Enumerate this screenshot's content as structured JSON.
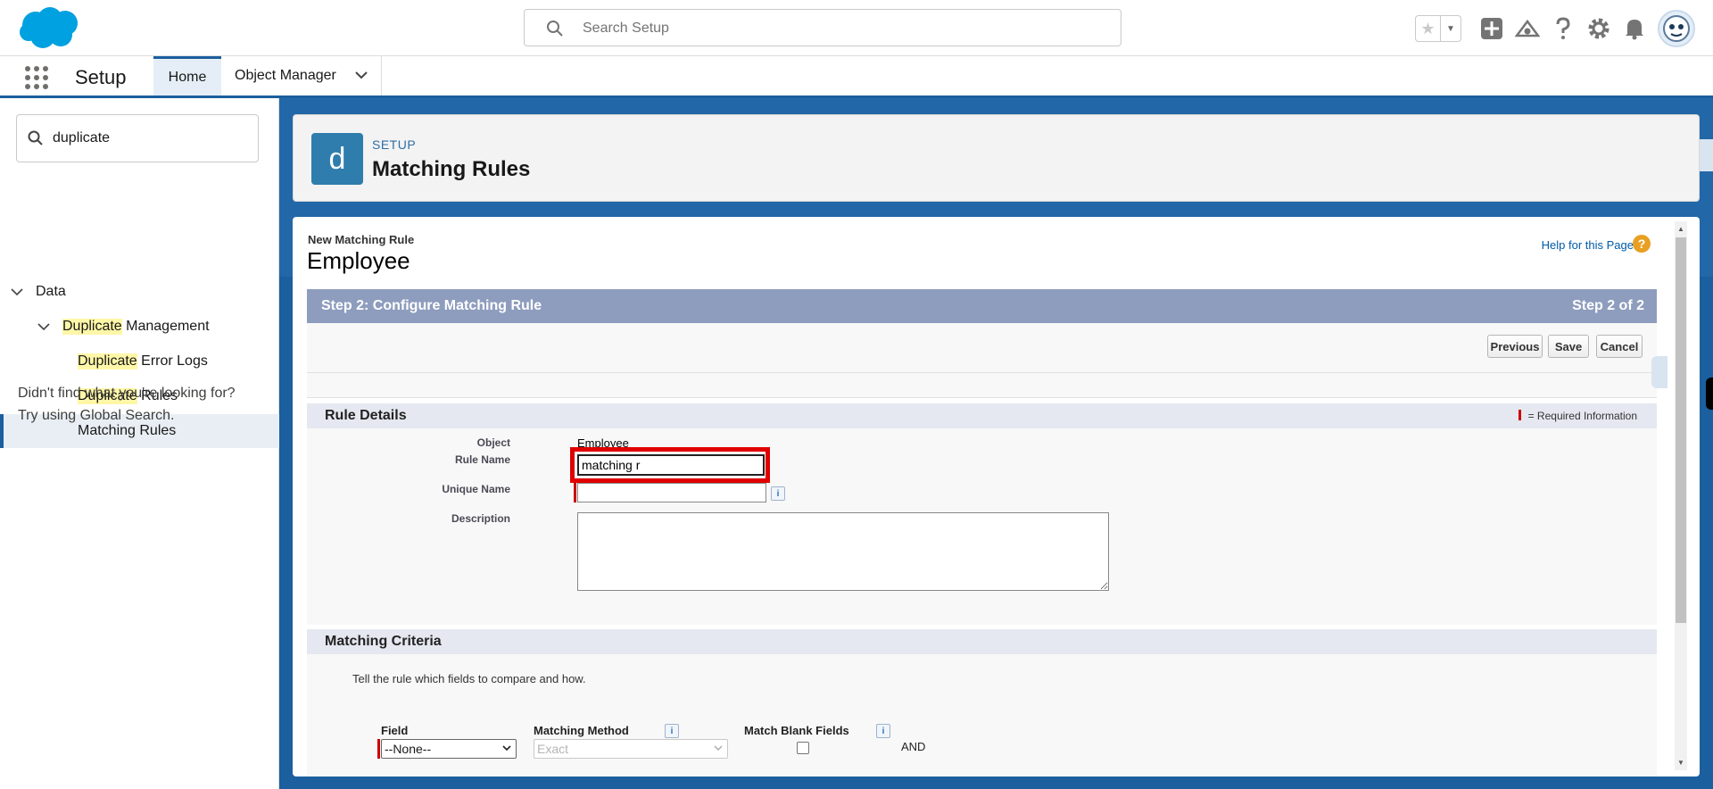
{
  "header": {
    "search_placeholder": "Search Setup",
    "brand_color": "#00a1e0"
  },
  "context_nav": {
    "app_name": "Setup",
    "tabs": [
      {
        "label": "Home"
      },
      {
        "label": "Object Manager"
      }
    ]
  },
  "sidebar": {
    "quick_find_value": "duplicate",
    "tree": {
      "data": "Data",
      "dup_mgmt_hl": "Duplicate",
      "dup_mgmt_rest": " Management",
      "error_logs_hl": "Duplicate",
      "error_logs_rest": " Error Logs",
      "rules_hl": "Duplicate",
      "rules_rest": " Rules",
      "matching_rules": "Matching Rules"
    },
    "help_line1": "Didn't find what you're looking for?",
    "help_line2": "Try using Global Search."
  },
  "page_header": {
    "icon_letter": "d",
    "eyebrow": "SETUP",
    "title": "Matching Rules"
  },
  "content": {
    "breadcrumb": "New Matching Rule",
    "record_title": "Employee",
    "help_link": "Help for this Page",
    "step_label": "Step 2: Configure Matching Rule",
    "step_count": "Step 2 of 2",
    "buttons": {
      "previous": "Previous",
      "save": "Save",
      "cancel": "Cancel"
    },
    "rule_details": {
      "title": "Rule Details",
      "required_info": "= Required Information",
      "object_label": "Object",
      "object_value": "Employee",
      "rule_name_label": "Rule Name",
      "rule_name_value": "matching r",
      "unique_name_label": "Unique Name",
      "unique_name_value": "",
      "description_label": "Description"
    },
    "matching_criteria": {
      "title": "Matching Criteria",
      "instructions": "Tell the rule which fields to compare and how.",
      "col_field": "Field",
      "col_method": "Matching Method",
      "col_blank": "Match Blank Fields",
      "field_value": "--None--",
      "method_value": "Exact",
      "and_label": "AND"
    }
  }
}
